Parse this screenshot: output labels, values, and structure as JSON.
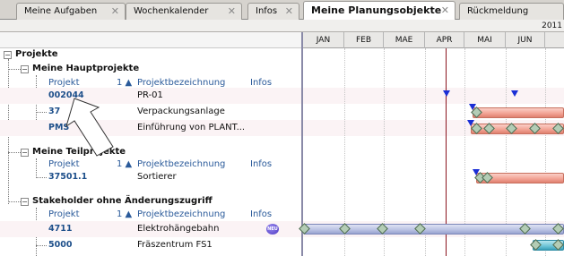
{
  "tabs": [
    {
      "label": "Meine Aufgaben"
    },
    {
      "label": "Wochenkalender"
    },
    {
      "label": "Infos"
    },
    {
      "label": "Meine Planungsobjekte"
    },
    {
      "label": "Rückmeldung"
    }
  ],
  "close_glyph": "✕",
  "year": "2011",
  "months": [
    "JAN",
    "FEB",
    "MAE",
    "APR",
    "MAI",
    "JUN"
  ],
  "tree": {
    "root": "Projekte",
    "groups": [
      {
        "title": "Meine Hauptprojekte",
        "col_projekt": "Projekt",
        "col_sort": "1 ▲",
        "col_bezeichnung": "Projektbezeichnung",
        "col_infos": "Infos",
        "items": [
          {
            "id": "002044",
            "name": "PR-01"
          },
          {
            "id": "37",
            "name": "Verpackungsanlage"
          },
          {
            "id": "PMS",
            "name": "Einführung von PLANT..."
          }
        ]
      },
      {
        "title": "Meine Teilprojekte",
        "col_projekt": "Projekt",
        "col_sort": "1 ▲",
        "col_bezeichnung": "Projektbezeichnung",
        "col_infos": "Infos",
        "items": [
          {
            "id": "37501.1",
            "name": "Sortierer"
          }
        ]
      },
      {
        "title": "Stakeholder ohne Änderungszugriff",
        "col_projekt": "Projekt",
        "col_sort": "1 ▲",
        "col_bezeichnung": "Projektbezeichnung",
        "col_infos": "Infos",
        "items": [
          {
            "id": "4711",
            "name": "Elektrohängebahn",
            "badge": "NEU"
          },
          {
            "id": "5000",
            "name": "Fräszentrum FS1"
          }
        ]
      }
    ]
  },
  "colors": {
    "today_line": "#8b1520",
    "milestone": "#1a2fd6",
    "bar_red": "#f1a092",
    "bar_blue": "#b8c0e2",
    "bar_teal": "#6cc4d6",
    "diamond": "#b3ccb5"
  }
}
